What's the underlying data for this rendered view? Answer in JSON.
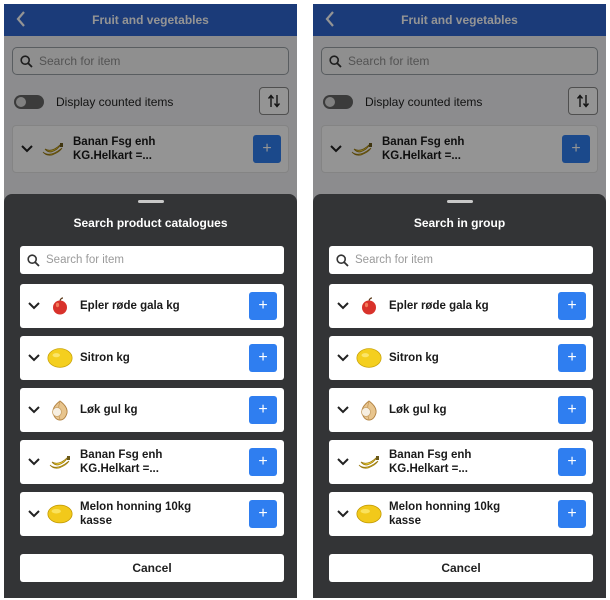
{
  "panels": [
    {
      "header": {
        "title": "Fruit and vegetables"
      },
      "search": {
        "placeholder": "Search for item"
      },
      "toggle": {
        "label": "Display counted items"
      },
      "background_item": {
        "name": "Banan Fsg enh\nKG.Helkart =..."
      },
      "sheet": {
        "title": "Search product catalogues",
        "search_placeholder": "Search for item",
        "items": [
          {
            "name": "Epler røde gala kg",
            "icon": "apple-icon"
          },
          {
            "name": "Sitron kg",
            "icon": "lemon-icon"
          },
          {
            "name": "Løk gul kg",
            "icon": "onion-icon"
          },
          {
            "name": "Banan Fsg enh\nKG.Helkart =...",
            "icon": "banana-icon"
          },
          {
            "name": "Melon honning 10kg\nkasse",
            "icon": "melon-icon"
          }
        ],
        "cancel_label": "Cancel"
      }
    },
    {
      "header": {
        "title": "Fruit and vegetables"
      },
      "search": {
        "placeholder": "Search for item"
      },
      "toggle": {
        "label": "Display counted items"
      },
      "background_item": {
        "name": "Banan Fsg enh\nKG.Helkart =..."
      },
      "sheet": {
        "title": "Search in group",
        "search_placeholder": "Search for item",
        "items": [
          {
            "name": "Epler røde gala kg",
            "icon": "apple-icon"
          },
          {
            "name": "Sitron kg",
            "icon": "lemon-icon"
          },
          {
            "name": "Løk gul kg",
            "icon": "onion-icon"
          },
          {
            "name": "Banan Fsg enh\nKG.Helkart =...",
            "icon": "banana-icon"
          },
          {
            "name": "Melon honning 10kg\nkasse",
            "icon": "melon-icon"
          }
        ],
        "cancel_label": "Cancel"
      }
    }
  ],
  "colors": {
    "accent": "#2f66d0",
    "button": "#2f7ef0",
    "sheet": "#333436"
  }
}
